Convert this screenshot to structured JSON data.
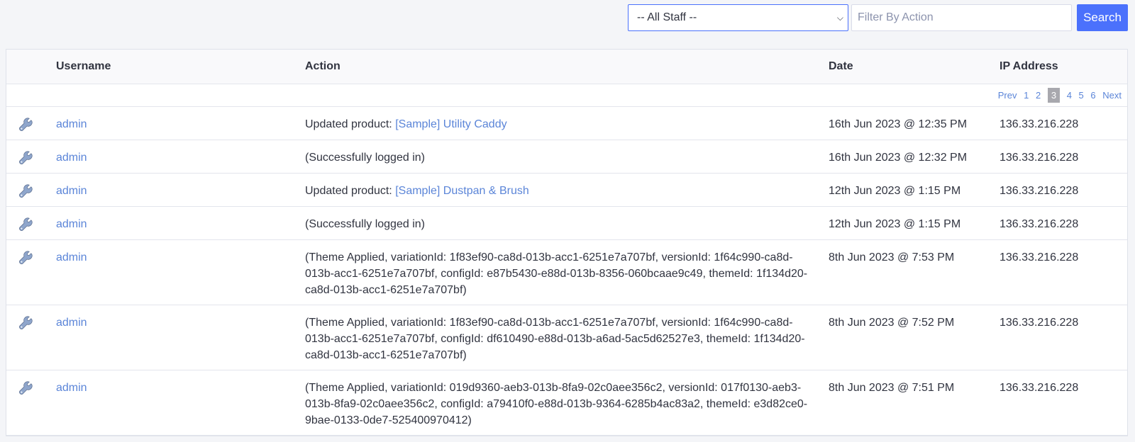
{
  "toolbar": {
    "staff_selected": "-- All Staff --",
    "filter_placeholder": "Filter By Action",
    "search_label": "Search"
  },
  "columns": {
    "username": "Username",
    "action": "Action",
    "date": "Date",
    "ip": "IP Address"
  },
  "pager": {
    "prev": "Prev",
    "pages": [
      "1",
      "2",
      "3",
      "4",
      "5",
      "6"
    ],
    "current": "3",
    "next": "Next"
  },
  "rows": [
    {
      "username": "admin",
      "action_prefix": "Updated product: ",
      "action_link": "[Sample] Utility Caddy",
      "action": "",
      "date": "16th Jun 2023 @ 12:35 PM",
      "ip": "136.33.216.228"
    },
    {
      "username": "admin",
      "action_prefix": "",
      "action_link": "",
      "action": "(Successfully logged in)",
      "date": "16th Jun 2023 @ 12:32 PM",
      "ip": "136.33.216.228"
    },
    {
      "username": "admin",
      "action_prefix": "Updated product: ",
      "action_link": "[Sample] Dustpan & Brush",
      "action": "",
      "date": "12th Jun 2023 @ 1:15 PM",
      "ip": "136.33.216.228"
    },
    {
      "username": "admin",
      "action_prefix": "",
      "action_link": "",
      "action": "(Successfully logged in)",
      "date": "12th Jun 2023 @ 1:15 PM",
      "ip": "136.33.216.228"
    },
    {
      "username": "admin",
      "action_prefix": "",
      "action_link": "",
      "action": "(Theme Applied, variationId: 1f83ef90-ca8d-013b-acc1-6251e7a707bf, versionId: 1f64c990-ca8d-013b-acc1-6251e7a707bf, configId: e87b5430-e88d-013b-8356-060bcaae9c49, themeId: 1f134d20-ca8d-013b-acc1-6251e7a707bf)",
      "date": "8th Jun 2023 @ 7:53 PM",
      "ip": "136.33.216.228"
    },
    {
      "username": "admin",
      "action_prefix": "",
      "action_link": "",
      "action": "(Theme Applied, variationId: 1f83ef90-ca8d-013b-acc1-6251e7a707bf, versionId: 1f64c990-ca8d-013b-acc1-6251e7a707bf, configId: df610490-e88d-013b-a6ad-5ac5d62527e3, themeId: 1f134d20-ca8d-013b-acc1-6251e7a707bf)",
      "date": "8th Jun 2023 @ 7:52 PM",
      "ip": "136.33.216.228"
    },
    {
      "username": "admin",
      "action_prefix": "",
      "action_link": "",
      "action": "(Theme Applied, variationId: 019d9360-aeb3-013b-8fa9-02c0aee356c2, versionId: 017f0130-aeb3-013b-8fa9-02c0aee356c2, configId: a79410f0-e88d-013b-9364-6285b4ac83a2, themeId: e3d82ce0-9bae-0133-0de7-525400970412)",
      "date": "8th Jun 2023 @ 7:51 PM",
      "ip": "136.33.216.228"
    }
  ],
  "icons": {
    "row_icon": "wrench-icon",
    "select_chevron": "chevron-down-icon"
  },
  "colors": {
    "accent": "#4b71fc",
    "link": "#5b85d8",
    "background": "#f4f5f8"
  }
}
